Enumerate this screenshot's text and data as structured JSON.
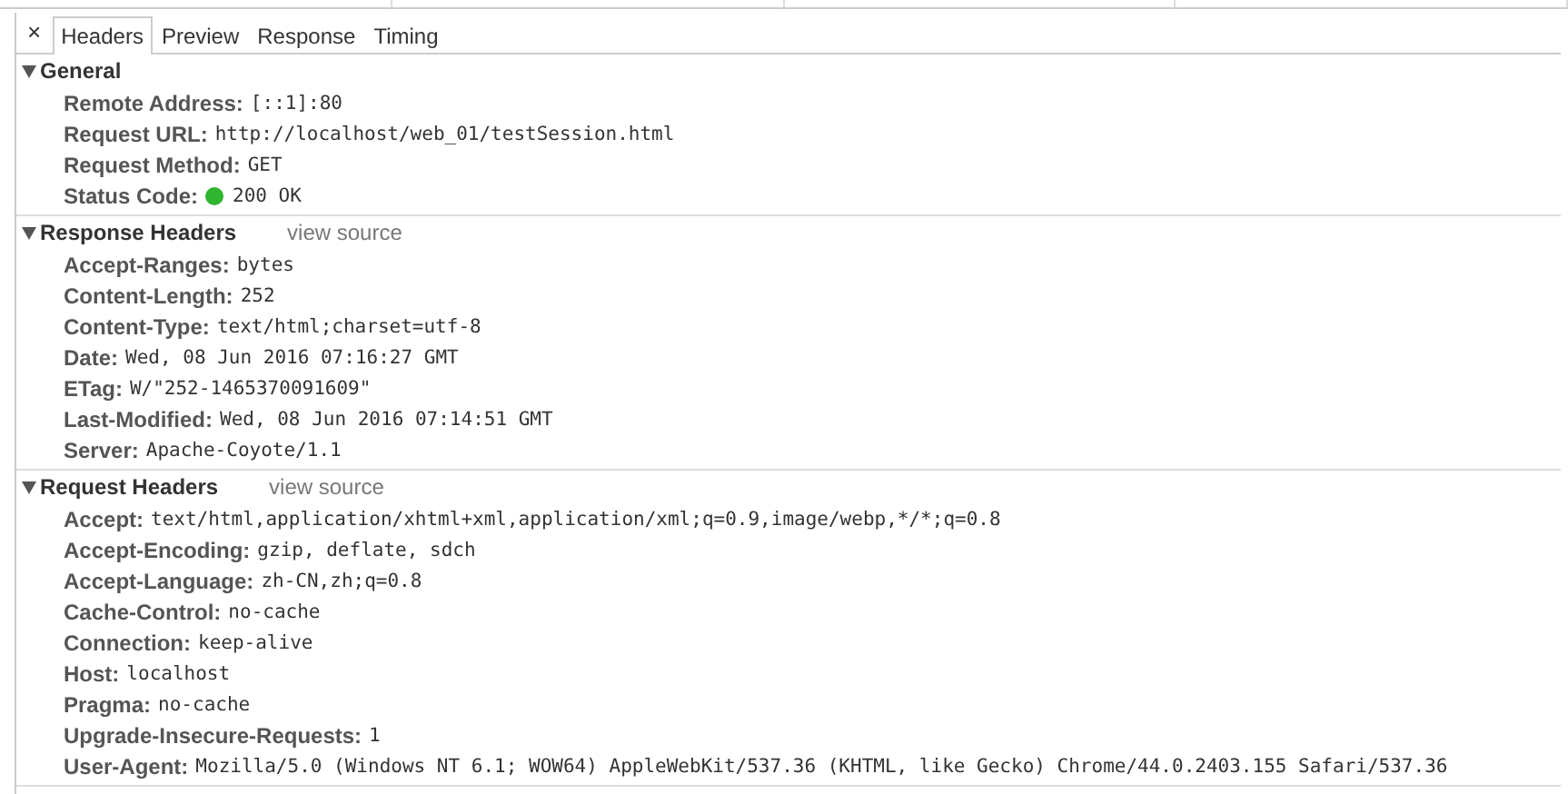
{
  "close_button": "×",
  "tabs": [
    {
      "label": "Headers",
      "selected": true
    },
    {
      "label": "Preview",
      "selected": false
    },
    {
      "label": "Response",
      "selected": false
    },
    {
      "label": "Timing",
      "selected": false
    }
  ],
  "sections": [
    {
      "title": "General",
      "expanded": true,
      "rows": [
        {
          "kind": "plain",
          "name": "Remote Address:",
          "value": "[::1]:80"
        },
        {
          "kind": "plain",
          "name": "Request URL:",
          "value": "http://localhost/web_01/testSession.html"
        },
        {
          "kind": "plain",
          "name": "Request Method:",
          "value": "GET"
        },
        {
          "kind": "status",
          "name": "Status Code:",
          "value": "200 OK"
        }
      ]
    },
    {
      "title": "Response Headers",
      "expanded": true,
      "view_source": "view source",
      "rows": [
        {
          "kind": "plain",
          "name": "Accept-Ranges:",
          "value": "bytes"
        },
        {
          "kind": "plain",
          "name": "Content-Length:",
          "value": "252"
        },
        {
          "kind": "plain",
          "name": "Content-Type:",
          "value": "text/html;charset=utf-8"
        },
        {
          "kind": "plain",
          "name": "Date:",
          "value": "Wed, 08 Jun 2016 07:16:27 GMT"
        },
        {
          "kind": "plain",
          "name": "ETag:",
          "value": "W/\"252-1465370091609\""
        },
        {
          "kind": "plain",
          "name": "Last-Modified:",
          "value": "Wed, 08 Jun 2016 07:14:51 GMT"
        },
        {
          "kind": "plain",
          "name": "Server:",
          "value": "Apache-Coyote/1.1"
        }
      ]
    },
    {
      "title": "Request Headers",
      "expanded": true,
      "view_source": "view source",
      "rows": [
        {
          "kind": "plain",
          "name": "Accept:",
          "value": "text/html,application/xhtml+xml,application/xml;q=0.9,image/webp,*/*;q=0.8"
        },
        {
          "kind": "plain",
          "name": "Accept-Encoding:",
          "value": "gzip, deflate, sdch"
        },
        {
          "kind": "plain",
          "name": "Accept-Language:",
          "value": "zh-CN,zh;q=0.8"
        },
        {
          "kind": "plain",
          "name": "Cache-Control:",
          "value": "no-cache"
        },
        {
          "kind": "plain",
          "name": "Connection:",
          "value": "keep-alive"
        },
        {
          "kind": "plain",
          "name": "Host:",
          "value": "localhost"
        },
        {
          "kind": "plain",
          "name": "Pragma:",
          "value": "no-cache"
        },
        {
          "kind": "plain",
          "name": "Upgrade-Insecure-Requests:",
          "value": "1"
        },
        {
          "kind": "plain",
          "name": "User-Agent:",
          "value": "Mozilla/5.0 (Windows NT 6.1; WOW64) AppleWebKit/537.36 (KHTML, like Gecko) Chrome/44.0.2403.155 Safari/537.36"
        }
      ]
    }
  ]
}
